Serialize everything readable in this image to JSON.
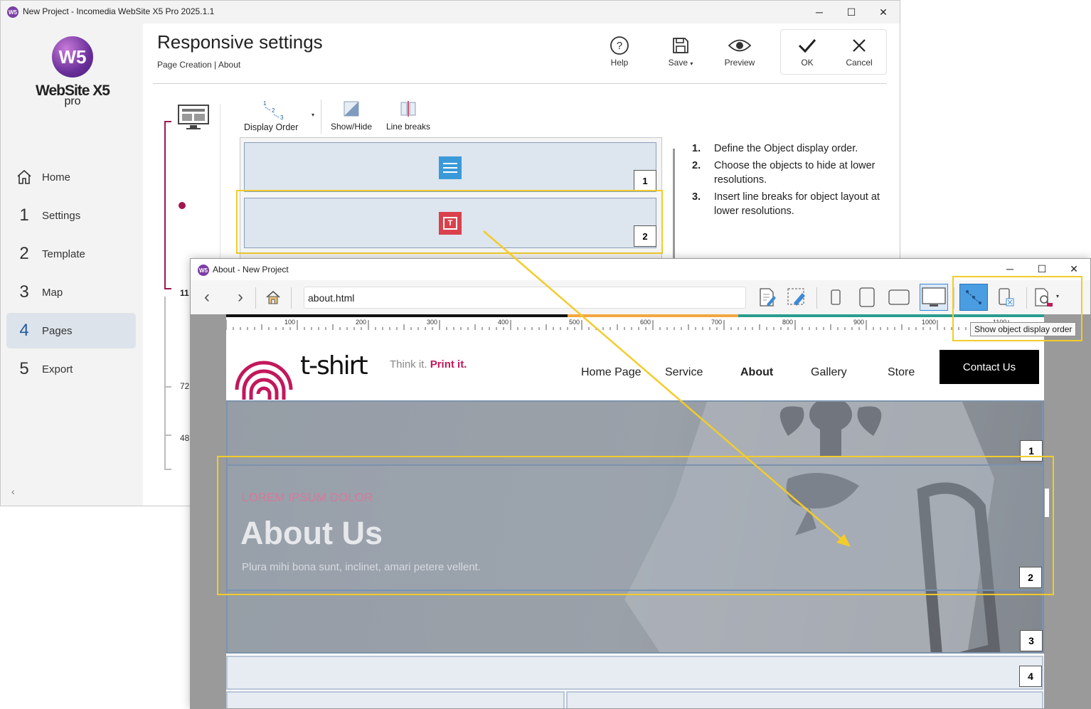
{
  "main_window": {
    "title": "New Project - Incomedia WebSite X5 Pro 2025.1.1",
    "logo_initials": "W5",
    "logo_name": "WebSite X5",
    "logo_edition": "pro",
    "page_title": "Responsive settings",
    "breadcrumb": "Page Creation | About",
    "header_buttons": {
      "help": "Help",
      "save": "Save",
      "preview": "Preview",
      "ok": "OK",
      "cancel": "Cancel"
    },
    "nav": [
      {
        "num": "",
        "label": "Home",
        "icon": "home-icon"
      },
      {
        "num": "1",
        "label": "Settings"
      },
      {
        "num": "2",
        "label": "Template"
      },
      {
        "num": "3",
        "label": "Map"
      },
      {
        "num": "4",
        "label": "Pages",
        "active": true
      },
      {
        "num": "5",
        "label": "Export"
      }
    ],
    "breakpoints": [
      "11",
      "72",
      "48"
    ],
    "toolbar": {
      "display_order": "Display Order",
      "show_hide": "Show/Hide",
      "line_breaks": "Line breaks"
    },
    "slots": [
      "1",
      "2"
    ],
    "instructions": [
      {
        "n": "1.",
        "text": "Define the Object display order."
      },
      {
        "n": "2.",
        "text": "Choose the objects to hide at lower resolutions."
      },
      {
        "n": "3.",
        "text": "Insert line breaks for object layout at lower resolutions."
      }
    ]
  },
  "preview_window": {
    "title": "About - New Project",
    "url": "about.html",
    "tooltip": "Show object display order",
    "ruler_labels": [
      "100",
      "200",
      "300",
      "400",
      "500",
      "600",
      "700",
      "800",
      "900",
      "1000",
      "1100"
    ],
    "site": {
      "logo_text": "t-shirt",
      "tagline_a": "Think it.",
      "tagline_b": "Print it.",
      "menu": [
        "Home Page",
        "Service",
        "About",
        "Gallery",
        "Store"
      ],
      "menu_active": "About",
      "cta": "Contact Us",
      "hero_kicker": "LOREM IPSUM DOLOR",
      "hero_title": "About Us",
      "hero_sub": "Plura mihi bona sunt, inclinet, amari petere vellent.",
      "object_numbers": [
        "1",
        "2",
        "3",
        "4"
      ]
    }
  },
  "colors": {
    "brand_purple": "#7b3fa5",
    "magenta_line": "#a0174e",
    "highlight_yellow": "#f2cc2a",
    "accent_red": "#d4145a",
    "ok_blue": "#3a8ad6"
  }
}
